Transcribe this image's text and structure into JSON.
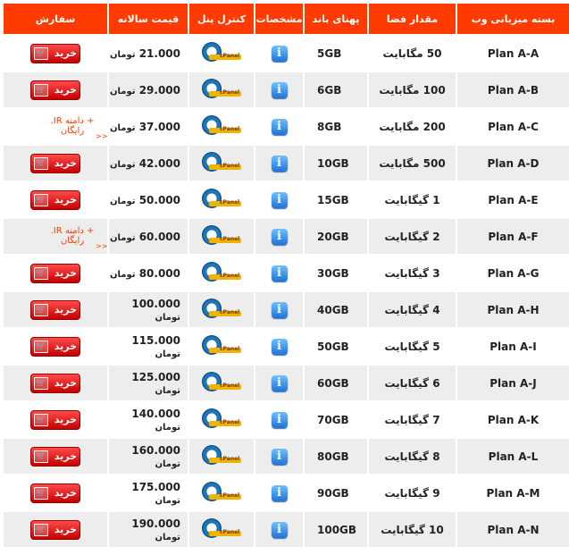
{
  "header": {
    "col_plan": "بسته میزبانی وب",
    "col_space": "مقدار فضا",
    "col_bandwidth": "پهنای باند",
    "col_specs": "مشخصات",
    "col_panel": "کنترل پنل",
    "col_price": "قیمت سالانه",
    "col_order": "سفارش"
  },
  "labels": {
    "buy": "خرید",
    "free_domain": "+ دامنه IR. رایگان",
    "more": "<<",
    "currency": "تومان",
    "cpanel_text": "cPanel"
  },
  "rows": [
    {
      "plan": "Plan A-A",
      "space": "50 مگابایت",
      "bandwidth": "5GB",
      "price": "21.000",
      "order": "buy"
    },
    {
      "plan": "Plan A-B",
      "space": "100 مگابایت",
      "bandwidth": "6GB",
      "price": "29.000",
      "order": "buy"
    },
    {
      "plan": "Plan A-C",
      "space": "200 مگابایت",
      "bandwidth": "8GB",
      "price": "37.000",
      "order": "free"
    },
    {
      "plan": "Plan A-D",
      "space": "500 مگابایت",
      "bandwidth": "10GB",
      "price": "42.000",
      "order": "buy"
    },
    {
      "plan": "Plan A-E",
      "space": "1 گیگابایت",
      "bandwidth": "15GB",
      "price": "50.000",
      "order": "buy"
    },
    {
      "plan": "Plan A-F",
      "space": "2 گیگابایت",
      "bandwidth": "20GB",
      "price": "60.000",
      "order": "free"
    },
    {
      "plan": "Plan A-G",
      "space": "3 گیگابایت",
      "bandwidth": "30GB",
      "price": "80.000",
      "order": "buy"
    },
    {
      "plan": "Plan A-H",
      "space": "4 گیگابایت",
      "bandwidth": "40GB",
      "price": "100.000",
      "order": "buy"
    },
    {
      "plan": "Plan A-I",
      "space": "5 گیگابایت",
      "bandwidth": "50GB",
      "price": "115.000",
      "order": "buy"
    },
    {
      "plan": "Plan A-J",
      "space": "6 گیگابایت",
      "bandwidth": "60GB",
      "price": "125.000",
      "order": "buy"
    },
    {
      "plan": "Plan A-K",
      "space": "7 گیگابایت",
      "bandwidth": "70GB",
      "price": "140.000",
      "order": "buy"
    },
    {
      "plan": "Plan A-L",
      "space": "8 گیگابایت",
      "bandwidth": "80GB",
      "price": "160.000",
      "order": "buy"
    },
    {
      "plan": "Plan A-M",
      "space": "9 گیگابایت",
      "bandwidth": "90GB",
      "price": "175.000",
      "order": "buy"
    },
    {
      "plan": "Plan A-N",
      "space": "10 گیگابایت",
      "bandwidth": "100GB",
      "price": "190.000",
      "order": "buy"
    }
  ],
  "colors": {
    "header_bg": "#ff3b00",
    "row_alt": "#ededed",
    "buy_button": "#d90000"
  }
}
